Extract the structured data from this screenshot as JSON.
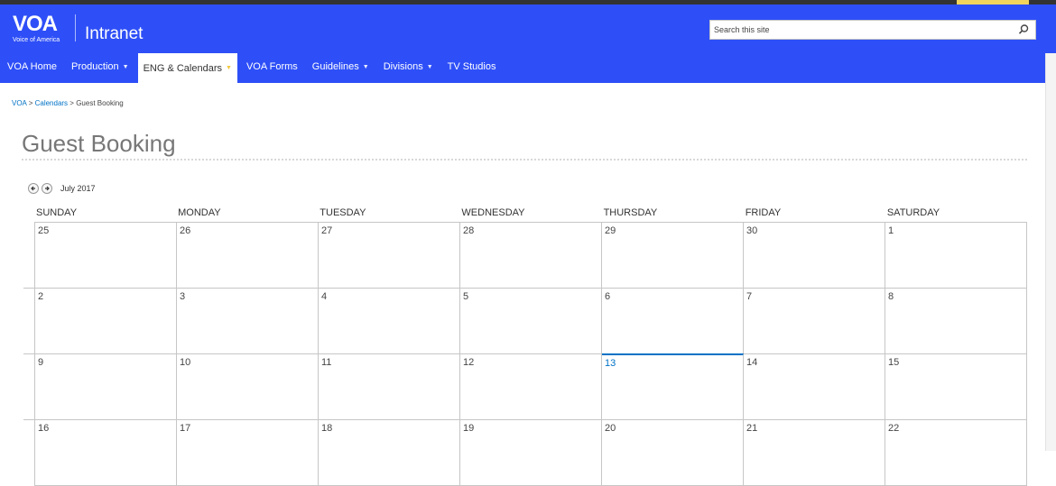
{
  "logo": {
    "mark": "VOA",
    "sub": "Voice of America"
  },
  "site_title": "Intranet",
  "search": {
    "placeholder": "Search this site"
  },
  "nav": [
    {
      "label": "VOA Home",
      "caret": false
    },
    {
      "label": "Production",
      "caret": true
    },
    {
      "label": "ENG & Calendars",
      "caret": true,
      "active": true
    },
    {
      "label": "VOA Forms",
      "caret": false
    },
    {
      "label": "Guidelines",
      "caret": true
    },
    {
      "label": "Divisions",
      "caret": true
    },
    {
      "label": "TV Studios",
      "caret": false
    }
  ],
  "breadcrumb": {
    "root": "VOA",
    "sep": ">",
    "parent": "Calendars",
    "current": "Guest Booking"
  },
  "page_title": "Guest Booking",
  "calendar": {
    "month_label": "July 2017",
    "days": [
      "SUNDAY",
      "MONDAY",
      "TUESDAY",
      "WEDNESDAY",
      "THURSDAY",
      "FRIDAY",
      "SATURDAY"
    ],
    "today": "13",
    "weeks": [
      [
        "25",
        "26",
        "27",
        "28",
        "29",
        "30",
        "1"
      ],
      [
        "2",
        "3",
        "4",
        "5",
        "6",
        "7",
        "8"
      ],
      [
        "9",
        "10",
        "11",
        "12",
        "13",
        "14",
        "15"
      ],
      [
        "16",
        "17",
        "18",
        "19",
        "20",
        "21",
        "22"
      ]
    ]
  },
  "colors": {
    "brand_blue": "#2e4ff7",
    "link": "#0072c6",
    "accent": "#f2d45c"
  }
}
